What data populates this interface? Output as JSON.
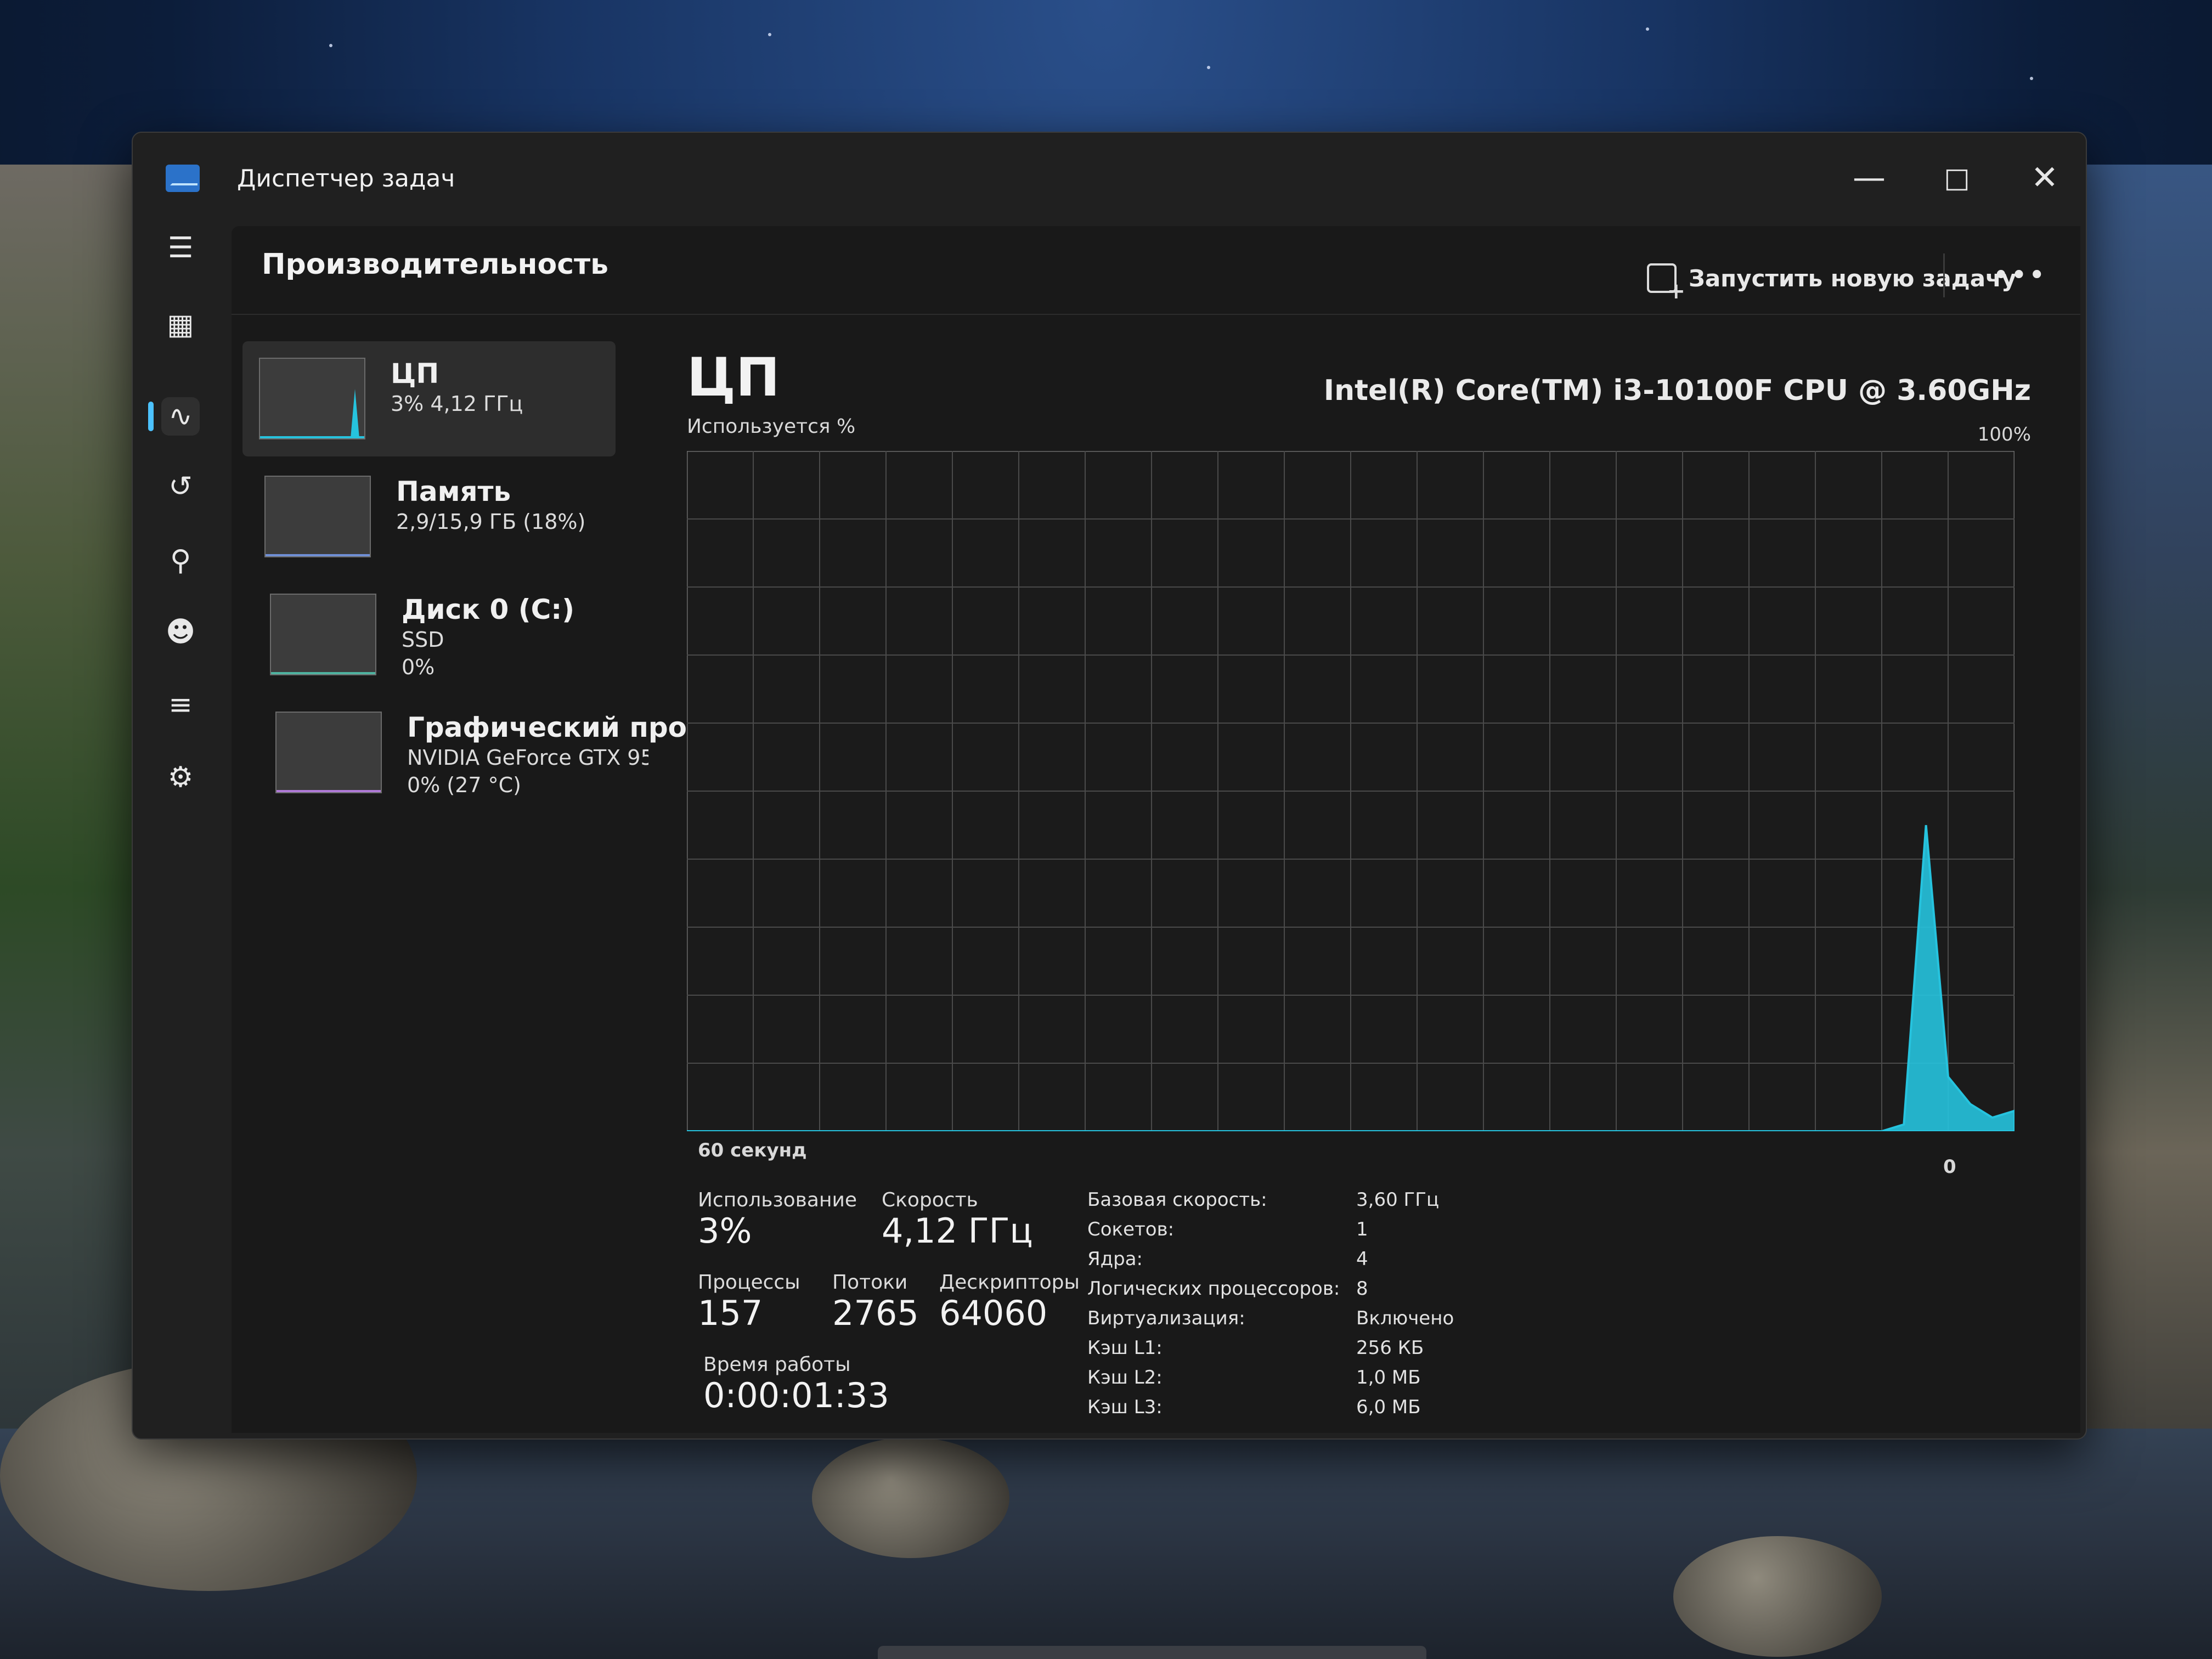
{
  "window": {
    "title": "Диспетчер задач"
  },
  "header": {
    "title": "Производительность",
    "new_task_label": "Запустить новую задачу",
    "more_label": "•••"
  },
  "devices": [
    {
      "name": "ЦП",
      "sub": "3% 4,12 ГГц",
      "sub2": ""
    },
    {
      "name": "Память",
      "sub": "2,9/15,9 ГБ (18%)",
      "sub2": ""
    },
    {
      "name": "Диск 0 (C:)",
      "sub": "SSD",
      "sub2": "0%"
    },
    {
      "name": "Графический про",
      "sub": "NVIDIA GeForce GTX 95(",
      "sub2": "0% (27 °C)"
    }
  ],
  "cpu": {
    "title": "ЦП",
    "model": "Intel(R) Core(TM) i3-10100F CPU @ 3.60GHz",
    "util_label": "Используется %",
    "max_label": "100%",
    "time_label": "60 секунд",
    "zero_label": "0",
    "usage_label": "Использование",
    "usage_value": "3%",
    "speed_label": "Скорость",
    "speed_value": "4,12 ГГц",
    "processes_label": "Процессы",
    "processes_value": "157",
    "threads_label": "Потоки",
    "threads_value": "2765",
    "handles_label": "Дескрипторы",
    "handles_value": "64060",
    "uptime_label": "Время работы",
    "uptime_value": "0:00:01:33",
    "specs": [
      {
        "key": "Базовая скорость:",
        "value": "3,60 ГГц"
      },
      {
        "key": "Сокетов:",
        "value": "1"
      },
      {
        "key": "Ядра:",
        "value": "4"
      },
      {
        "key": "Логических процессоров:",
        "value": "8"
      },
      {
        "key": "Виртуализация:",
        "value": "Включено"
      },
      {
        "key": "Кэш L1:",
        "value": "256 КБ"
      },
      {
        "key": "Кэш L2:",
        "value": "1,0 МБ"
      },
      {
        "key": "Кэш L3:",
        "value": "6,0 МБ"
      }
    ]
  },
  "chart_data": {
    "type": "area",
    "x": [
      0,
      1,
      2,
      3,
      4,
      5,
      6,
      7,
      8,
      9,
      10,
      11,
      12,
      13,
      14,
      15,
      16,
      17,
      18,
      19,
      20,
      21,
      22,
      23,
      24,
      25,
      26,
      27,
      28,
      29,
      30,
      31,
      32,
      33,
      34,
      35,
      36,
      37,
      38,
      39,
      40,
      41,
      42,
      43,
      44,
      45,
      46,
      47,
      48,
      49,
      50,
      51,
      52,
      53,
      54,
      55,
      56,
      57,
      58,
      59,
      60
    ],
    "series": [
      {
        "values": [
          0,
          0,
          0,
          0,
          0,
          0,
          0,
          0,
          0,
          0,
          0,
          0,
          0,
          0,
          0,
          0,
          0,
          0,
          0,
          0,
          0,
          0,
          0,
          0,
          0,
          0,
          0,
          0,
          0,
          0,
          0,
          0,
          0,
          0,
          0,
          0,
          0,
          0,
          0,
          0,
          0,
          0,
          0,
          0,
          0,
          0,
          0,
          0,
          0,
          0,
          0,
          0,
          0,
          0,
          0,
          1,
          45,
          8,
          4,
          2,
          3
        ]
      }
    ],
    "xlabel": "60 секунд",
    "ylabel": "Используется %",
    "ylim": [
      0,
      100
    ],
    "grid": true,
    "color": "#26c3de"
  }
}
